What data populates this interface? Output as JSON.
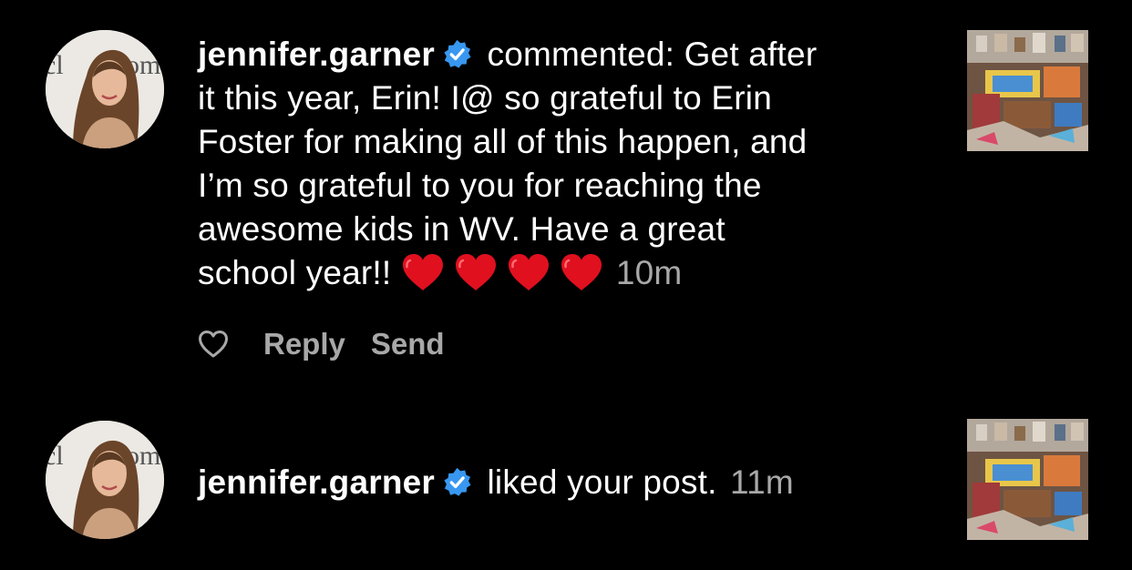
{
  "notifications": [
    {
      "username": "jennifer.garner",
      "verified": true,
      "text_lines": [
        " commented: Get after",
        "it this year, Erin!  I@ so grateful to Erin",
        "Foster for making all of this happen, and",
        "I’m so grateful to you for reaching the",
        "awesome kids in WV.  Have a great",
        "school year!! "
      ],
      "emoji": [
        "red-heart",
        "red-heart",
        "red-heart",
        "red-heart"
      ],
      "time": "10m",
      "actions": {
        "like_icon": "heart-outline-icon",
        "reply_label": "Reply",
        "send_label": "Send"
      }
    },
    {
      "username": "jennifer.garner",
      "verified": true,
      "text": " liked your post. ",
      "time": "11m"
    }
  ],
  "colors": {
    "background": "#000000",
    "text": "#ffffff",
    "muted": "#a8a8a8",
    "verified_badge": "#3897f0",
    "heart": "#e0101f"
  }
}
